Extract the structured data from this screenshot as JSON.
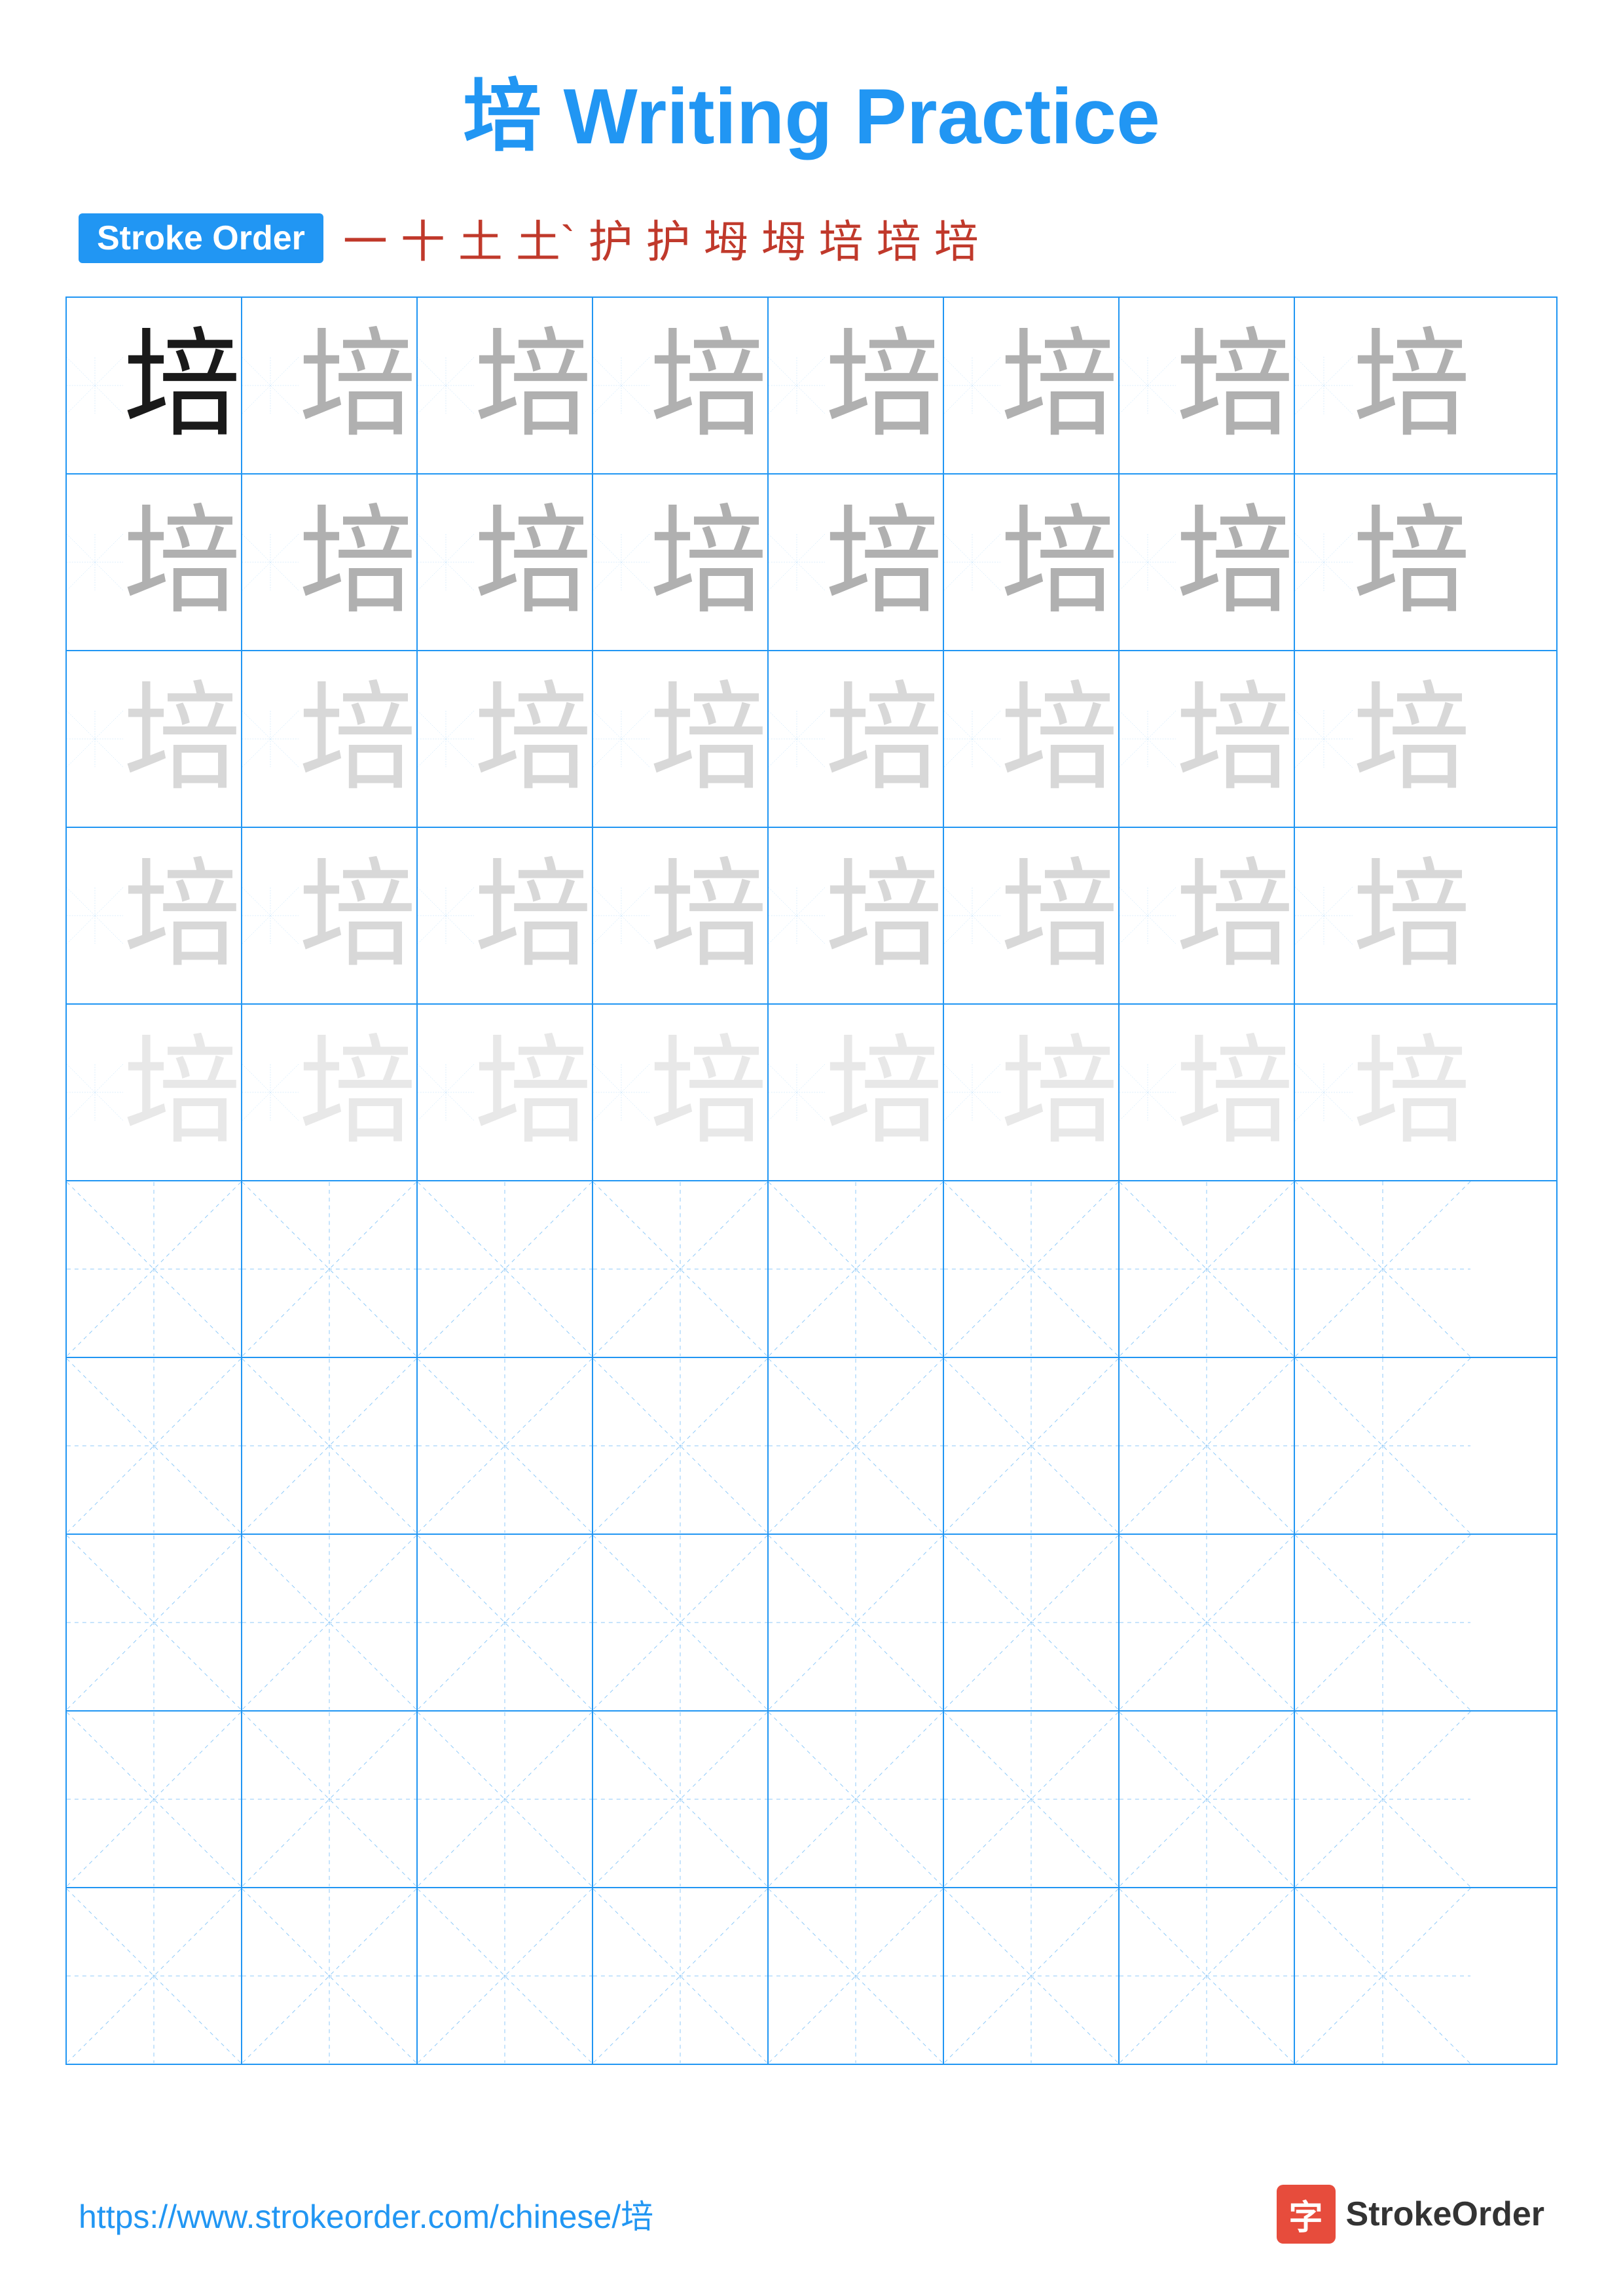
{
  "title": {
    "character": "培",
    "label": "Writing Practice",
    "full": "培 Writing Practice"
  },
  "stroke_order": {
    "badge_label": "Stroke Order",
    "strokes": [
      "一",
      "十",
      "土",
      "土`",
      "护",
      "护",
      "坶",
      "坶",
      "培",
      "培",
      "培"
    ]
  },
  "grid": {
    "rows": 10,
    "cols": 8,
    "character": "培"
  },
  "footer": {
    "url": "https://www.strokeorder.com/chinese/培",
    "logo_char": "字",
    "logo_label": "StrokeOrder"
  },
  "colors": {
    "blue": "#2196F3",
    "red": "#c0392b",
    "dark": "#1a1a1a",
    "medium": "#b0b0b0",
    "light": "#d0d0d0",
    "vlight": "#e2e2e2"
  }
}
